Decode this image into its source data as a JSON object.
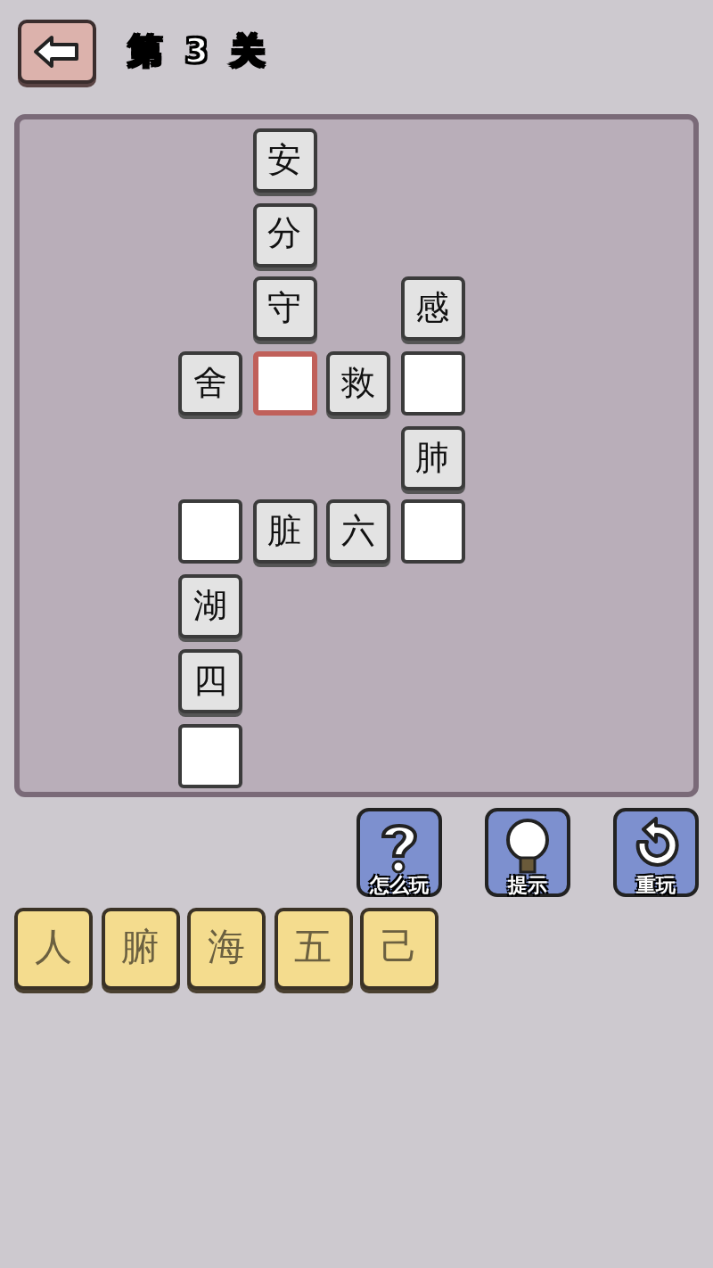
{
  "header": {
    "title": "第 3 关"
  },
  "board": {
    "rows": [
      {
        "cells": [
          {
            "kind": "none"
          },
          {
            "kind": "char",
            "text": "安"
          },
          {
            "kind": "none"
          },
          {
            "kind": "none"
          }
        ]
      },
      {
        "cells": [
          {
            "kind": "none"
          },
          {
            "kind": "char",
            "text": "分"
          },
          {
            "kind": "none"
          },
          {
            "kind": "none"
          }
        ]
      },
      {
        "cells": [
          {
            "kind": "none"
          },
          {
            "kind": "char",
            "text": "守"
          },
          {
            "kind": "none"
          },
          {
            "kind": "char",
            "text": "感"
          }
        ]
      },
      {
        "cells": [
          {
            "kind": "char",
            "text": "舍"
          },
          {
            "kind": "blank",
            "selected": true
          },
          {
            "kind": "char",
            "text": "救"
          },
          {
            "kind": "blank",
            "selected": false
          }
        ]
      },
      {
        "cells": [
          {
            "kind": "none"
          },
          {
            "kind": "none"
          },
          {
            "kind": "none"
          },
          {
            "kind": "char",
            "text": "肺"
          }
        ]
      },
      {
        "cells": [
          {
            "kind": "blank",
            "selected": false
          },
          {
            "kind": "char",
            "text": "脏"
          },
          {
            "kind": "char",
            "text": "六"
          },
          {
            "kind": "blank",
            "selected": false
          }
        ]
      },
      {
        "cells": [
          {
            "kind": "char",
            "text": "湖"
          },
          {
            "kind": "none"
          },
          {
            "kind": "none"
          },
          {
            "kind": "none"
          }
        ]
      },
      {
        "cells": [
          {
            "kind": "char",
            "text": "四"
          },
          {
            "kind": "none"
          },
          {
            "kind": "none"
          },
          {
            "kind": "none"
          }
        ]
      },
      {
        "cells": [
          {
            "kind": "blank",
            "selected": false
          },
          {
            "kind": "none"
          },
          {
            "kind": "none"
          },
          {
            "kind": "none"
          }
        ]
      }
    ]
  },
  "actions": [
    {
      "kind": "help",
      "label": "怎么玩"
    },
    {
      "kind": "hint",
      "label": "提示"
    },
    {
      "kind": "replay",
      "label": "重玩"
    }
  ],
  "choices": [
    {
      "text": "人"
    },
    {
      "text": "腑"
    },
    {
      "text": "海"
    },
    {
      "text": "五"
    },
    {
      "text": "己"
    }
  ]
}
